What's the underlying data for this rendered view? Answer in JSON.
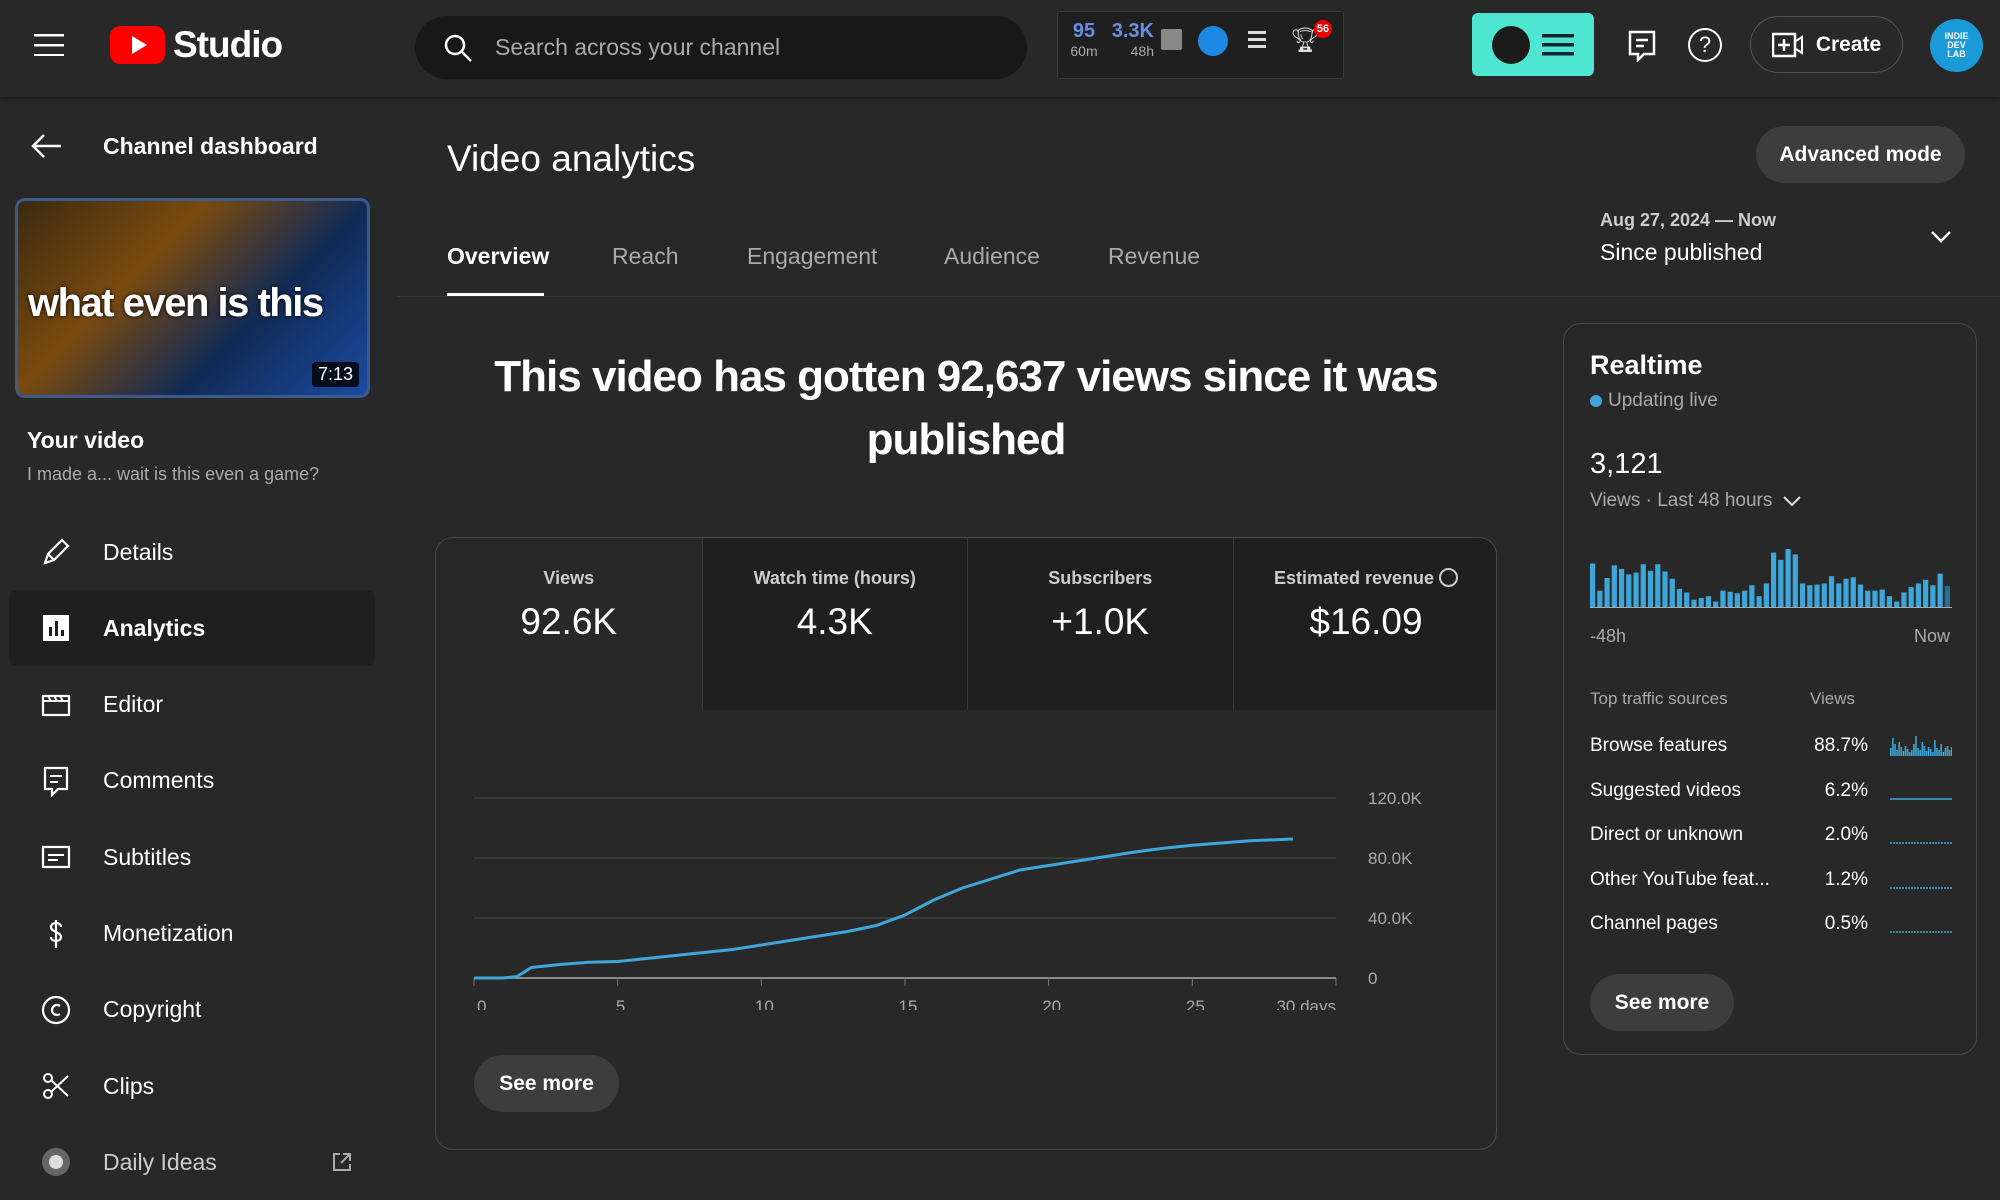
{
  "header": {
    "app_name": "Studio",
    "search_placeholder": "Search across your channel",
    "ext": {
      "views_60m": "95",
      "label_60m": "60m",
      "views_48h": "3.3K",
      "label_48h": "48h",
      "badge": "56"
    },
    "create_label": "Create",
    "avatar_text": "INDIE DEV LAB"
  },
  "sidebar": {
    "back_label": "Channel dashboard",
    "thumbnail": {
      "overlay_text": "what even is this",
      "duration": "7:13"
    },
    "your_video_label": "Your video",
    "video_title": "I made a... wait is this even a game?",
    "items": [
      {
        "label": "Details",
        "icon": "pencil-icon"
      },
      {
        "label": "Analytics",
        "icon": "analytics-icon",
        "active": true
      },
      {
        "label": "Editor",
        "icon": "clapperboard-icon"
      },
      {
        "label": "Comments",
        "icon": "comment-icon"
      },
      {
        "label": "Subtitles",
        "icon": "subtitles-icon"
      },
      {
        "label": "Monetization",
        "icon": "dollar-icon"
      },
      {
        "label": "Copyright",
        "icon": "copyright-icon"
      },
      {
        "label": "Clips",
        "icon": "scissors-icon"
      },
      {
        "label": "Daily Ideas",
        "icon": "daily-ideas-icon",
        "external": true
      }
    ]
  },
  "main": {
    "title": "Video analytics",
    "advanced_mode_label": "Advanced mode",
    "tabs": [
      {
        "label": "Overview",
        "active": true
      },
      {
        "label": "Reach"
      },
      {
        "label": "Engagement"
      },
      {
        "label": "Audience"
      },
      {
        "label": "Revenue"
      }
    ],
    "date_range": {
      "range": "Aug 27, 2024 — Now",
      "label": "Since published"
    },
    "headline": "This video has gotten 92,637 views since it was published",
    "metrics": [
      {
        "label": "Views",
        "value": "92.6K",
        "selected": true
      },
      {
        "label": "Watch time (hours)",
        "value": "4.3K"
      },
      {
        "label": "Subscribers",
        "value": "+1.0K"
      },
      {
        "label": "Estimated revenue",
        "value": "$16.09"
      }
    ],
    "see_more_label": "See more"
  },
  "chart_data": {
    "type": "line",
    "xlabel": "",
    "ylabel": "",
    "xlim": [
      0,
      30
    ],
    "ylim": [
      0,
      120000
    ],
    "x_ticks": [
      "0",
      "5",
      "10",
      "15",
      "20",
      "25",
      "30 days"
    ],
    "y_ticks": [
      "120.0K",
      "80.0K",
      "40.0K",
      "0"
    ],
    "grid": true,
    "color": "#3ea6d8",
    "x": [
      0,
      1,
      1.5,
      2,
      3,
      4,
      5,
      6,
      7,
      8,
      9,
      10,
      11,
      12,
      13,
      14,
      15,
      16,
      17,
      18,
      19,
      20,
      21,
      22,
      23,
      24,
      25,
      26,
      27,
      28.5
    ],
    "y": [
      0,
      0,
      1000,
      7000,
      9000,
      10500,
      11000,
      13000,
      15000,
      17000,
      19000,
      22000,
      25000,
      28000,
      31000,
      35000,
      42000,
      52000,
      60000,
      66000,
      72000,
      75000,
      78000,
      81000,
      84000,
      86500,
      88500,
      90000,
      91500,
      92637
    ]
  },
  "realtime": {
    "title": "Realtime",
    "status": "Updating live",
    "status_color": "#3ea6d8",
    "views": "3,121",
    "period_label": "Views · Last 48 hours",
    "start_label": "-48h",
    "end_label": "Now",
    "bars": [
      120,
      45,
      80,
      115,
      105,
      90,
      95,
      118,
      100,
      118,
      98,
      78,
      50,
      40,
      20,
      25,
      30,
      15,
      45,
      42,
      38,
      45,
      60,
      30,
      65,
      150,
      130,
      160,
      145,
      65,
      60,
      62,
      65,
      85,
      65,
      78,
      82,
      62,
      45,
      45,
      48,
      30,
      15,
      40,
      55,
      65,
      75,
      60,
      92,
      58
    ],
    "sources_header": "Top traffic sources",
    "views_header": "Views",
    "sources": [
      {
        "name": "Browse features",
        "pct": "88.7%"
      },
      {
        "name": "Suggested videos",
        "pct": "6.2%"
      },
      {
        "name": "Direct or unknown",
        "pct": "2.0%"
      },
      {
        "name": "Other YouTube feat...",
        "pct": "1.2%"
      },
      {
        "name": "Channel pages",
        "pct": "0.5%"
      }
    ],
    "see_more_label": "See more"
  }
}
